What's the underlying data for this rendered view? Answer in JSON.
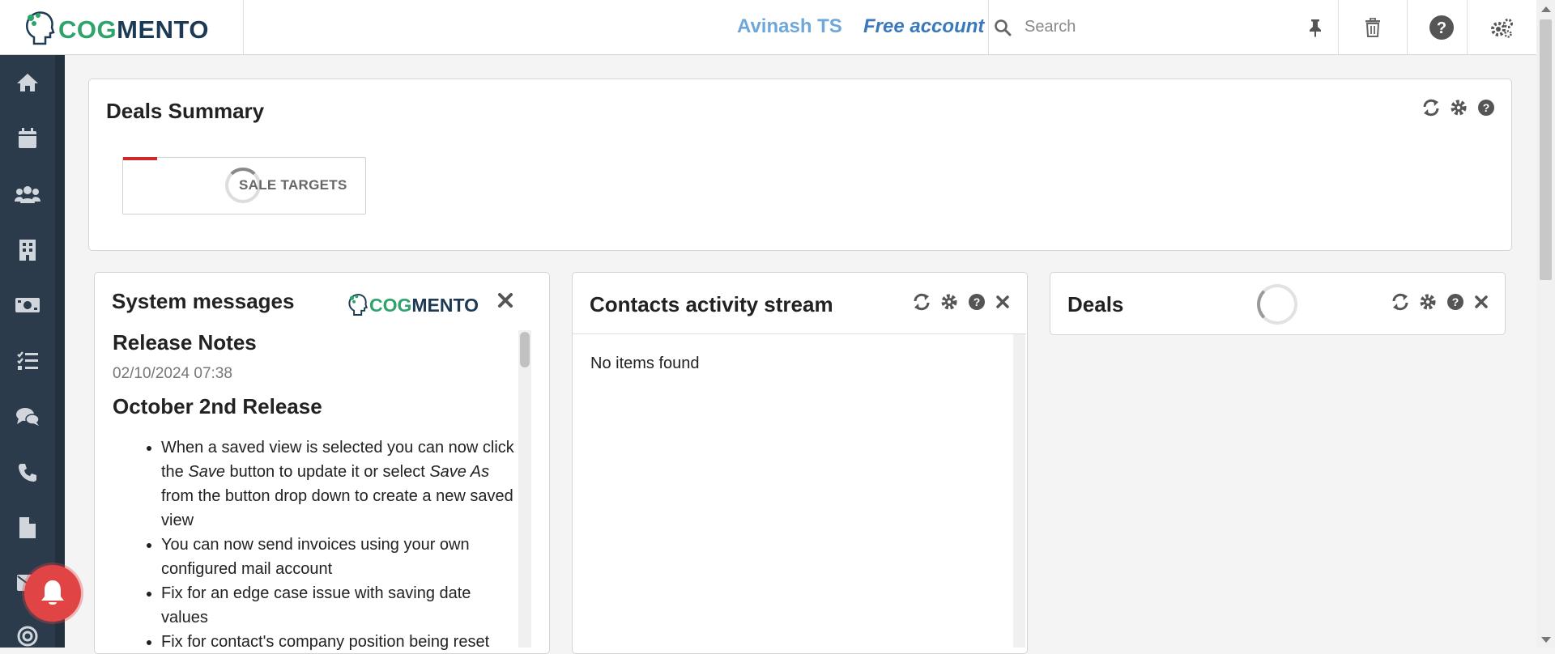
{
  "header": {
    "logo_text_a": "COG",
    "logo_text_b": "MENTO",
    "user_name": "Avinash TS",
    "account_type": "Free account",
    "search_placeholder": "Search"
  },
  "sidebar": {
    "items": [
      {
        "icon": "home-icon"
      },
      {
        "icon": "calendar-icon"
      },
      {
        "icon": "contacts-icon"
      },
      {
        "icon": "companies-icon"
      },
      {
        "icon": "deals-icon"
      },
      {
        "icon": "tasks-icon"
      },
      {
        "icon": "cases-icon"
      },
      {
        "icon": "calls-icon"
      },
      {
        "icon": "documents-icon"
      },
      {
        "icon": "email-icon"
      },
      {
        "icon": "campaigns-icon"
      }
    ]
  },
  "deals_summary": {
    "title": "Deals Summary",
    "sale_targets_label": "SALE TARGETS"
  },
  "system_messages": {
    "title": "System messages",
    "logo_text_a": "COG",
    "logo_text_b": "MENTO",
    "release_notes_title": "Release Notes",
    "release_date": "02/10/2024 07:38",
    "release_name": "October 2nd Release",
    "items": [
      {
        "pre": "When a saved view is selected you can now click the ",
        "em1": "Save",
        "mid": " button to update it or select ",
        "em2": "Save As",
        "post": " from the button drop down to create a new saved view"
      },
      {
        "pre": "You can now send invoices using your own configured mail account",
        "em1": "",
        "mid": "",
        "em2": "",
        "post": ""
      },
      {
        "pre": "Fix for an edge case issue with saving date values",
        "em1": "",
        "mid": "",
        "em2": "",
        "post": ""
      },
      {
        "pre": "Fix for contact's company position being reset",
        "em1": "",
        "mid": "",
        "em2": "",
        "post": ""
      }
    ]
  },
  "contacts_activity": {
    "title": "Contacts activity stream",
    "empty_text": "No items found"
  },
  "deals": {
    "title": "Deals"
  },
  "colors": {
    "brand_green": "#2ea36b",
    "brand_navy": "#1d3a54",
    "sidebar_bg": "#2b3b4c",
    "user_name": "#6ea8da",
    "account": "#3a78bd",
    "notification_red": "#e04444"
  }
}
